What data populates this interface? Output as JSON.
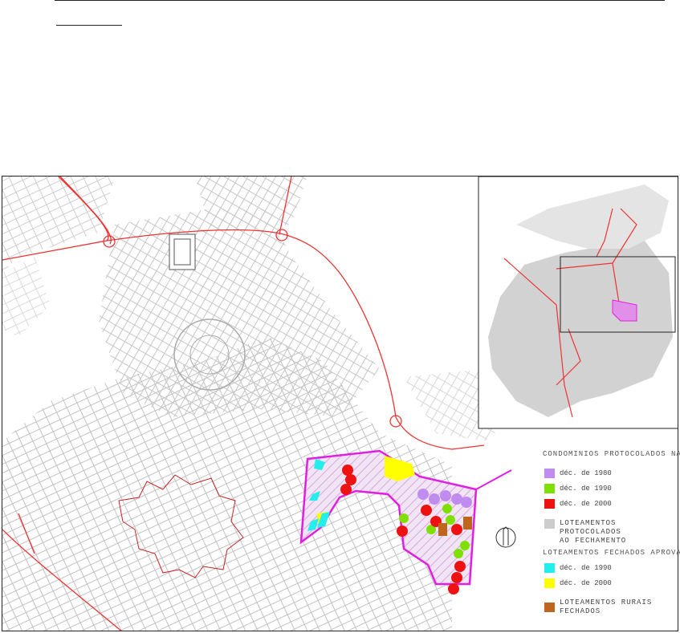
{
  "legend": {
    "title_condominios": "CONDOMINIOS PROTOCOLADOS NA",
    "cond_1980": "déc. de 1980",
    "cond_1990": "déc. de 1990",
    "cond_2000": "déc. de 2000",
    "loteamentos_protocolados": "LOTEAMENTOS PROTOCOLADOS\nAO FECHAMENTO",
    "title_loteamentos_fechados": "LOTEAMENTOS FECHADOS APROVADOS NA",
    "lot_1990": "déc. de 1990",
    "lot_2000": "déc. de 2000",
    "rurais": "LOTEAMENTOS RURAIS FECHADOS"
  },
  "colors": {
    "cond_1980": "#c08cf0",
    "cond_1990": "#7fe000",
    "cond_2000": "#ee1111",
    "loteamentos_protocolados": "#cccccc",
    "lot_1990": "#22eeee",
    "lot_2000": "#ffff00",
    "rurais": "#c0651e",
    "study_area_outline": "#e020e0",
    "center_outline": "#cc2222",
    "roads": "#ee3333",
    "streets": "#b8b8b8"
  },
  "icons": {
    "north_arrow": "north-arrow-icon"
  }
}
